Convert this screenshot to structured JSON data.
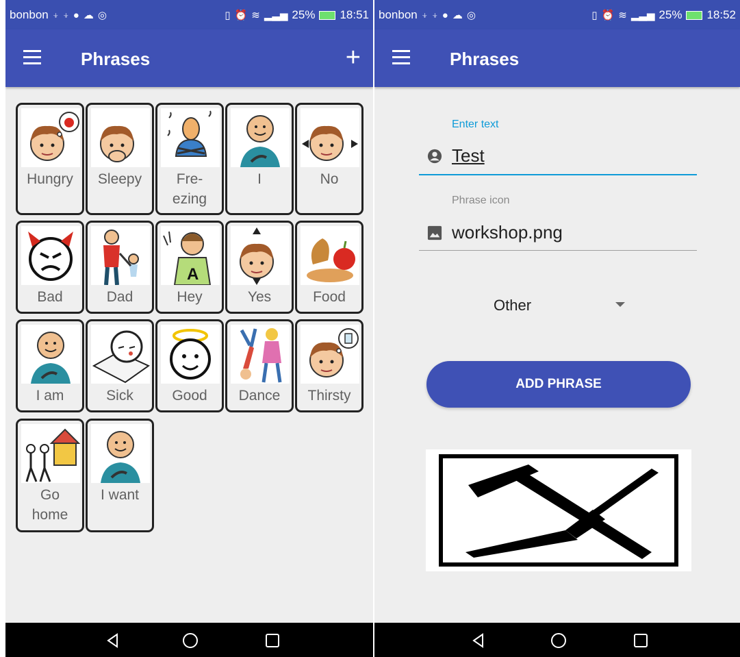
{
  "left": {
    "status": {
      "carrier": "bonbon",
      "battery": "25%",
      "time": "18:51"
    },
    "appbar": {
      "title": "Phrases",
      "add_icon": "plus-icon"
    },
    "tiles": [
      {
        "label": "Hungry",
        "icon": "hungry-boy-icon"
      },
      {
        "label": "Sleepy",
        "icon": "yawning-boy-icon"
      },
      {
        "label": "Fre-\nezing",
        "icon": "freezing-man-icon"
      },
      {
        "label": "I",
        "icon": "pointing-self-icon"
      },
      {
        "label": "No",
        "icon": "shaking-head-icon"
      },
      {
        "label": "Bad",
        "icon": "devil-face-icon"
      },
      {
        "label": "Dad",
        "icon": "father-child-icon"
      },
      {
        "label": "Hey",
        "icon": "waving-person-icon"
      },
      {
        "label": "Yes",
        "icon": "nodding-head-icon"
      },
      {
        "label": "Food",
        "icon": "food-icon"
      },
      {
        "label": "I am",
        "icon": "pointing-self-icon"
      },
      {
        "label": "Sick",
        "icon": "sick-in-bed-icon"
      },
      {
        "label": "Good",
        "icon": "halo-face-icon"
      },
      {
        "label": "Dance",
        "icon": "dancing-people-icon"
      },
      {
        "label": "Thirsty",
        "icon": "thirsty-boy-icon"
      },
      {
        "label": "Go\nhome",
        "icon": "go-home-icon"
      },
      {
        "label": "I want",
        "icon": "pointing-self-icon"
      }
    ]
  },
  "right": {
    "status": {
      "carrier": "bonbon",
      "battery": "25%",
      "time": "18:52"
    },
    "appbar": {
      "title": "Phrases"
    },
    "text_field": {
      "label": "Enter text",
      "value": "Test"
    },
    "icon_field": {
      "label": "Phrase icon",
      "value": "workshop.png"
    },
    "category": {
      "selected": "Other"
    },
    "add_button": "ADD PHRASE",
    "preview_icon": "hammer-screwdriver-icon"
  },
  "colors": {
    "primary": "#3f51b5",
    "status_bar": "#3a4fb0",
    "accent": "#0e9bd8",
    "background": "#eeeeee"
  }
}
